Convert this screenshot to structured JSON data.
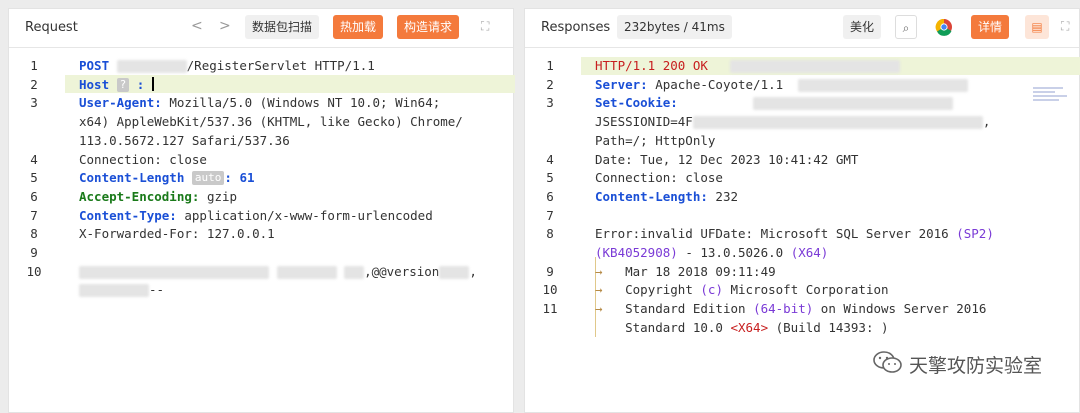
{
  "request": {
    "title": "Request",
    "nav_prev": "<",
    "nav_next": ">",
    "capture_label": "数据包扫描",
    "hot_load_label": "热加载",
    "build_label": "构造请求",
    "expand_icon": "expand-icon",
    "lines": {
      "l1_method": "POST",
      "l1_rest": "/RegisterServlet HTTP/1.1",
      "l2_key": "Host",
      "l2_badge": "?",
      "l3_key": "User-Agent:",
      "l3_val": "Mozilla/5.0 (Windows NT 10.0; Win64;",
      "l3_cont1": "x64) AppleWebKit/537.36 (KHTML, like Gecko) Chrome/",
      "l3_cont2": "113.0.5672.127 Safari/537.36",
      "l4": "Connection: close",
      "l5_key": "Content-Length",
      "l5_badge": "auto",
      "l5_val": ": 61",
      "l6_key": "Accept-Encoding:",
      "l6_val": "gzip",
      "l7_key": "Content-Type:",
      "l7_val": "application/x-www-form-urlencoded",
      "l8": "X-Forwarded-For: 127.0.0.1",
      "l10_visible": ",@@version",
      "l10_cont": "--"
    },
    "line_numbers": [
      "1",
      "2",
      "3",
      "4",
      "5",
      "6",
      "7",
      "8",
      "9",
      "10"
    ]
  },
  "response": {
    "title": "Responses",
    "size_label": "232bytes / 41ms",
    "beautify_label": "美化",
    "detail_label": "详情",
    "search_icon": "search-icon",
    "chrome_icon": "chrome-icon",
    "chat_icon": "chat-icon",
    "expand_icon": "expand-icon",
    "lines": {
      "l1": "HTTP/1.1 200 OK",
      "l2_key": "Server:",
      "l2_val": "Apache-Coyote/1.1",
      "l3_key": "Set-Cookie:",
      "l3_cont1": "JSESSIONID=4F",
      "l3_cont2": "Path=/; HttpOnly",
      "l4": "Date: Tue, 12 Dec 2023 10:41:42 GMT",
      "l5": "Connection: close",
      "l6_key": "Content-Length:",
      "l6_val": "232",
      "l8_a": "Error:invalid UFDate: Microsoft SQL Server 2016 ",
      "l8_b": "(SP2)",
      "l8_c": "(KB4052908)",
      "l8_d": " - 13.0.5026.0 ",
      "l8_e": "(X64)",
      "l9": "Mar 18 2018 09:11:49",
      "l10_a": "Copyright ",
      "l10_b": "(c)",
      "l10_c": " Microsoft Corporation",
      "l11_a": "Standard Edition ",
      "l11_b": "(64-bit)",
      "l11_c": " on Windows Server 2016",
      "l11_cont_a": "Standard 10.0 ",
      "l11_cont_b": "<X64>",
      "l11_cont_c": " (Build 14393: )"
    },
    "line_numbers": [
      "1",
      "2",
      "3",
      "4",
      "5",
      "6",
      "7",
      "8",
      "9",
      "10",
      "11"
    ]
  },
  "watermark": {
    "text": "天擎攻防实验室",
    "icon": "wechat-icon"
  }
}
